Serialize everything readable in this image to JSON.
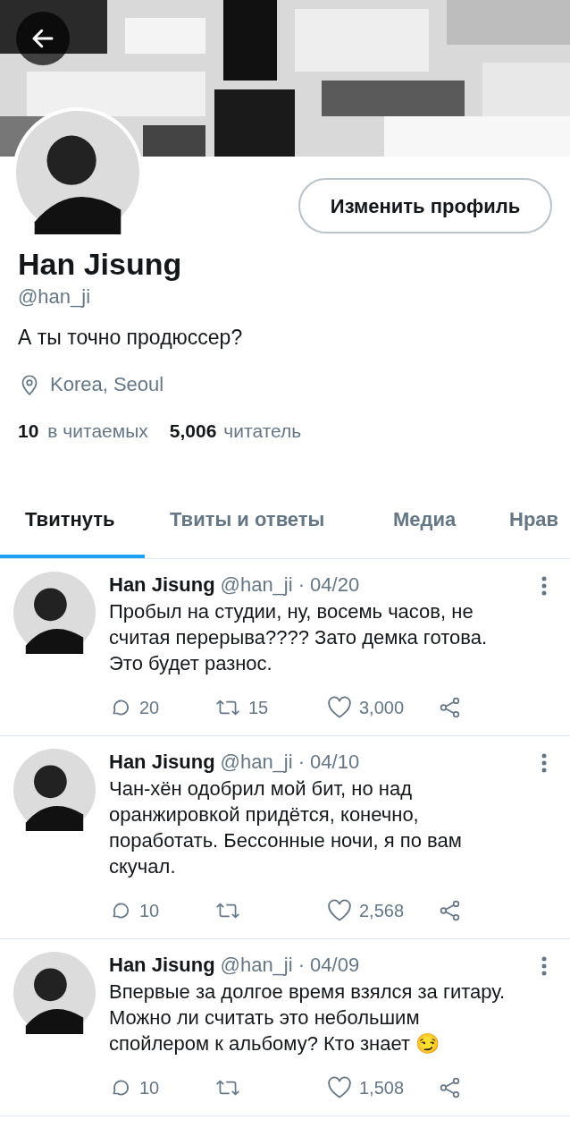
{
  "profile": {
    "edit_button": "Изменить профиль",
    "name": "Han Jisung",
    "handle": "@han_ji",
    "bio": "А ты точно продюссер?",
    "location": "Korea, Seoul",
    "following_count": "10",
    "following_label": "в читаемых",
    "followers_count": "5,006",
    "followers_label": "читатель"
  },
  "tabs": [
    {
      "label": "Твитнуть",
      "selected": true
    },
    {
      "label": "Твиты и ответы",
      "selected": false
    },
    {
      "label": "Медиа",
      "selected": false
    },
    {
      "label": "Нрав",
      "selected": false
    }
  ],
  "tweets": [
    {
      "name": "Han Jisung",
      "handle": "@han_ji",
      "date": "· 04/20",
      "text": "Пробыл на студии, ну, восемь часов, не считая перерыва???? Зато демка готова. Это будет разнос.",
      "replies": "20",
      "retweets": "15",
      "likes": "3,000"
    },
    {
      "name": "Han Jisung",
      "handle": "@han_ji",
      "date": "· 04/10",
      "text": "Чан-хён одобрил мой бит, но над оранжировкой придётся, конечно, поработать. Бессонные ночи, я по вам скучал.",
      "replies": "10",
      "likes": "2,568"
    },
    {
      "name": "Han Jisung",
      "handle": "@han_ji",
      "date": "· 04/09",
      "text": "Впервые за долгое время взялся за гитару. Можно ли считать это небольшим спойлером к альбому? Кто знает 😏",
      "replies": "10",
      "likes": "1,508"
    }
  ]
}
